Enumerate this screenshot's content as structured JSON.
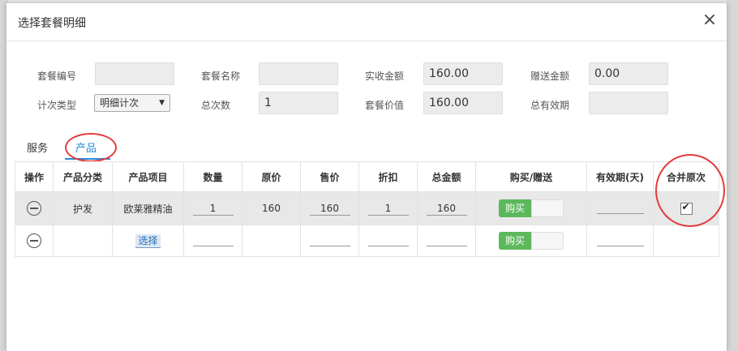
{
  "dialog": {
    "title": "选择套餐明细",
    "close_glyph": "×"
  },
  "form": {
    "package_no": {
      "label": "套餐编号",
      "value": ""
    },
    "package_name": {
      "label": "套餐名称",
      "value": ""
    },
    "actual_amount": {
      "label": "实收金额",
      "value": "160.00"
    },
    "gift_amount": {
      "label": "赠送金额",
      "value": "0.00"
    },
    "count_type": {
      "label": "计次类型",
      "value": "明细计次"
    },
    "total_count": {
      "label": "总次数",
      "value": "1"
    },
    "package_value": {
      "label": "套餐价值",
      "value": "160.00"
    },
    "total_validity": {
      "label": "总有效期",
      "value": ""
    }
  },
  "tabs": [
    {
      "label": "服务",
      "active": false
    },
    {
      "label": "产品",
      "active": true
    }
  ],
  "table": {
    "headers": [
      "操作",
      "产品分类",
      "产品项目",
      "数量",
      "原价",
      "售价",
      "折扣",
      "总金额",
      "购买/赠送",
      "有效期(天)",
      "合并原次"
    ],
    "rows": [
      {
        "category": "护发",
        "item": "欧莱雅精油",
        "qty": "1",
        "original_price": "160",
        "sale_price": "160",
        "discount": "1",
        "total": "160",
        "mode": "购买",
        "validity": "",
        "merge_checked": true
      },
      {
        "category": "",
        "item": "选择",
        "qty": "",
        "original_price": "",
        "sale_price": "",
        "discount": "",
        "total": "",
        "mode": "购买",
        "validity": "",
        "merge_checked": false
      }
    ]
  },
  "colors": {
    "accent": "#2a8ad4",
    "toggle_on": "#5cb85c",
    "annotation": "#e23b3b"
  },
  "icons": {
    "remove_row": "minus-circle-icon",
    "dropdown": "caret-down-icon",
    "check": "checkmark-icon"
  }
}
